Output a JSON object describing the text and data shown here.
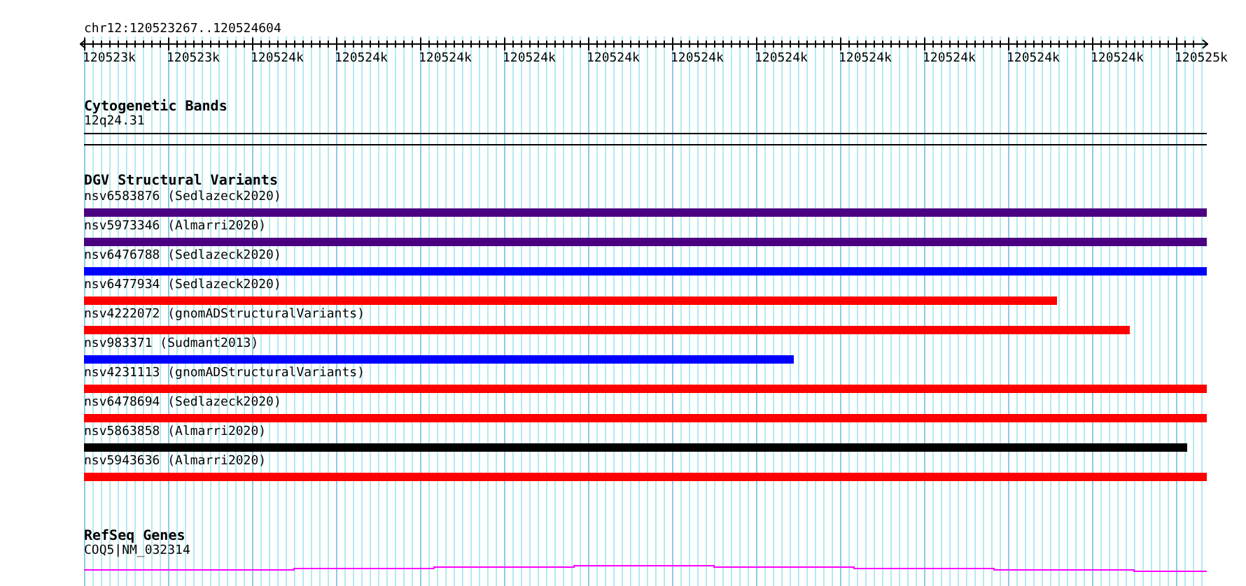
{
  "ruler": {
    "range": "chr12:120523267..120524604",
    "labels": [
      "120523k",
      "120523k",
      "120524k",
      "120524k",
      "120524k",
      "120524k",
      "120524k",
      "120524k",
      "120524k",
      "120524k",
      "120524k",
      "120524k",
      "120524k",
      "120525k"
    ]
  },
  "cytogenetic_bands": {
    "title": "Cytogenetic Bands",
    "band": "12q24.31"
  },
  "dgv_structural_variants": {
    "title": "DGV Structural Variants",
    "features": [
      {
        "label": "nsv6583876 (Sedlazeck2020)",
        "color": "#4b0082",
        "level": 1
      },
      {
        "label": "nsv5973346 (Almarri2020)",
        "color": "#4b0082",
        "level": 1
      },
      {
        "label": "nsv6476788 (Sedlazeck2020)",
        "color": "#0000ff",
        "level": 1
      },
      {
        "label": "nsv6477934 (Sedlazeck2020)",
        "color": "#ff0000",
        "level": 0.867
      },
      {
        "label": "nsv4222072 (gnomADStructuralVariants)",
        "color": "#ff0000",
        "level": 0.932
      },
      {
        "label": "nsv983371 (Sudmant2013)",
        "color": "#0000ff",
        "level": 0.632
      },
      {
        "label": "nsv4231113 (gnomADStructuralVariants)",
        "color": "#ff0000",
        "level": 1
      },
      {
        "label": "nsv6478694 (Sedlazeck2020)",
        "color": "#ff0000",
        "level": 1
      },
      {
        "label": "nsv5863858 (Almarri2020)",
        "color": "#000000",
        "level": 0.983
      },
      {
        "label": "nsv5943636 (Almarri2020)",
        "color": "#ff0000",
        "level": 1
      }
    ]
  },
  "refseq_genes": {
    "title": "RefSeq Genes",
    "gene": "COQ5|NM_032314"
  }
}
